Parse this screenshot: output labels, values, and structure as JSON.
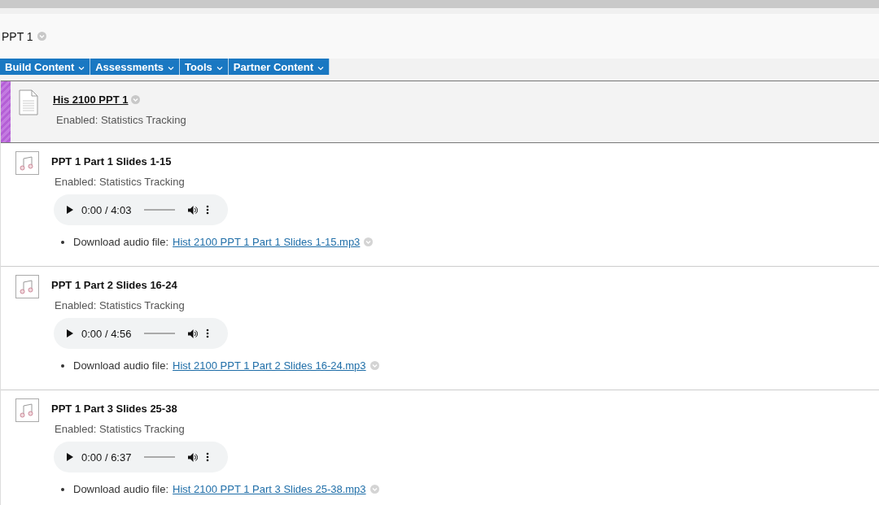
{
  "page": {
    "title": "PPT 1"
  },
  "menu": [
    {
      "label": "Build Content"
    },
    {
      "label": "Assessments"
    },
    {
      "label": "Tools"
    },
    {
      "label": "Partner Content"
    }
  ],
  "items": [
    {
      "kind": "document",
      "title": "His 2100 PPT 1",
      "selected": true,
      "status": "Enabled:  Statistics Tracking"
    },
    {
      "kind": "audio",
      "title": "PPT 1 Part 1 Slides 1-15",
      "selected": false,
      "status": "Enabled:  Statistics Tracking",
      "time": "0:00 / 4:03",
      "download_label": "Download audio file:",
      "file": "Hist 2100 PPT 1 Part 1 Slides 1-15.mp3"
    },
    {
      "kind": "audio",
      "title": "PPT 1 Part 2 Slides 16-24",
      "selected": false,
      "status": "Enabled:  Statistics Tracking",
      "time": "0:00 / 4:56",
      "download_label": "Download audio file:",
      "file": "Hist 2100 PPT 1 Part 2 Slides 16-24.mp3"
    },
    {
      "kind": "audio",
      "title": "PPT 1 Part 3 Slides 25-38",
      "selected": false,
      "status": "Enabled:  Statistics Tracking",
      "time": "0:00 / 6:37",
      "download_label": "Download audio file:",
      "file": "Hist 2100 PPT 1 Part 3 Slides 25-38.mp3"
    }
  ]
}
